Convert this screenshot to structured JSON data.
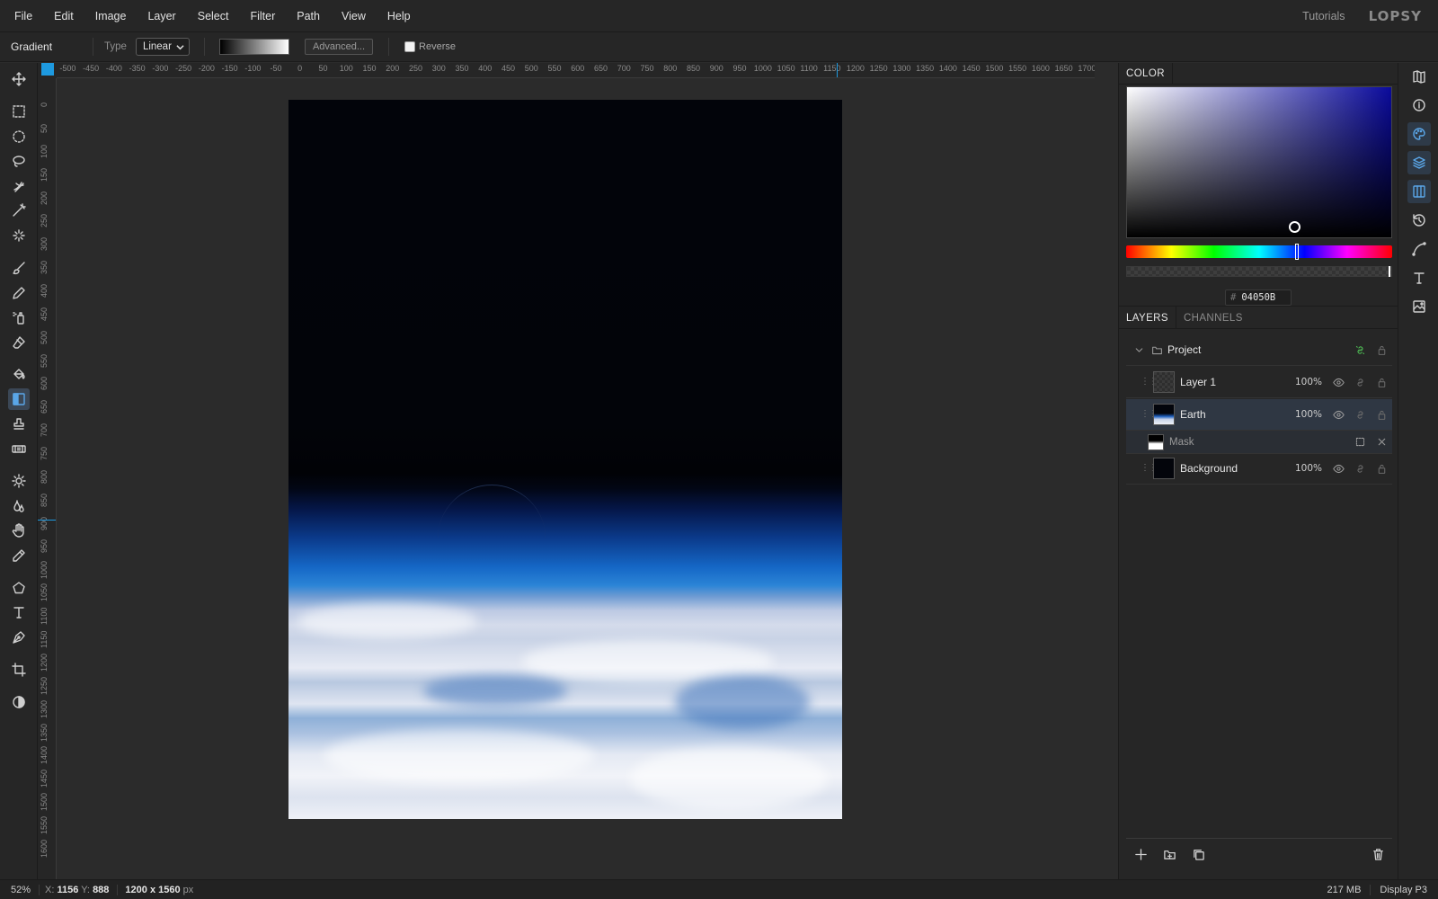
{
  "menubar": {
    "items": [
      "File",
      "Edit",
      "Image",
      "Layer",
      "Select",
      "Filter",
      "Path",
      "View",
      "Help"
    ],
    "tutorials": "Tutorials",
    "logo": "LOPSY"
  },
  "options": {
    "tool_name": "Gradient",
    "type_label": "Type",
    "type_value": "Linear",
    "advanced_label": "Advanced...",
    "reverse_label": "Reverse",
    "reverse_checked": false
  },
  "tools": [
    "move-icon",
    "rect-select-icon",
    "ellipse-select-icon",
    "lasso-icon",
    "quick-select-icon",
    "magic-wand-icon",
    "object-select-icon",
    "brush-icon",
    "pencil-icon",
    "spray-icon",
    "eraser-icon",
    "fill-bucket-icon",
    "gradient-icon",
    "stamp-icon",
    "healing-icon",
    "dodge-icon",
    "blur-icon",
    "hand-icon",
    "eyedropper-icon",
    "polygon-icon",
    "text-icon",
    "pen-icon",
    "crop-icon",
    "contrast-icon"
  ],
  "active_tool": "gradient-icon",
  "rulers": {
    "h_labels": [
      "-500",
      "-450",
      "-400",
      "-350",
      "-300",
      "-250",
      "-200",
      "-150",
      "-100",
      "-50",
      "0",
      "50",
      "100",
      "150",
      "200",
      "250",
      "300",
      "350",
      "400",
      "450",
      "500",
      "550",
      "600",
      "650",
      "700",
      "750",
      "800",
      "850",
      "900",
      "950",
      "1000",
      "1050",
      "1100",
      "1150",
      "1200",
      "1250",
      "1300",
      "1350",
      "1400",
      "1450",
      "1500",
      "1550",
      "1600",
      "1650",
      "1700"
    ],
    "v_labels": [
      "0",
      "50",
      "100",
      "150",
      "200",
      "250",
      "300",
      "350",
      "400",
      "450",
      "500",
      "550",
      "600",
      "650",
      "700",
      "750",
      "800",
      "850",
      "900",
      "950",
      "1000",
      "1050",
      "1100",
      "1150",
      "1200",
      "1250",
      "1300",
      "1350",
      "1400",
      "1450",
      "1500",
      "1550",
      "1600"
    ]
  },
  "color_panel": {
    "tab": "COLOR",
    "hex_prefix": "#",
    "hex": "04050B",
    "accent": "#1e9ae0"
  },
  "layers_panel": {
    "tabs": [
      "LAYERS",
      "CHANNELS"
    ],
    "group": {
      "name": "Project"
    },
    "layers": [
      {
        "name": "Layer 1",
        "opacity": "100%"
      },
      {
        "name": "Earth",
        "opacity": "100%"
      },
      {
        "name": "Mask"
      },
      {
        "name": "Background",
        "opacity": "100%"
      }
    ]
  },
  "right_icons": [
    "map-icon",
    "info-icon",
    "palette-icon",
    "layers-icon",
    "columns-icon",
    "history-icon",
    "curve-icon",
    "type-icon",
    "image-edit-icon"
  ],
  "status": {
    "zoom": "52%",
    "x_label": "X:",
    "x_value": "1156",
    "y_label": "Y:",
    "y_value": "888",
    "doc_size": "1200 x 1560",
    "doc_unit": "px",
    "memory": "217 MB",
    "profile": "Display P3"
  }
}
